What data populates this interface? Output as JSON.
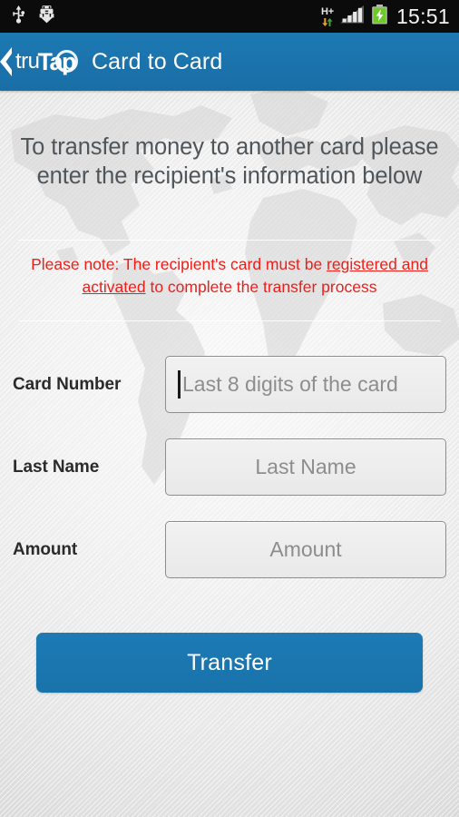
{
  "statusbar": {
    "time": "15:51",
    "network_type": "H+",
    "icons": [
      "usb-icon",
      "android-debug-icon",
      "network-hplus-icon",
      "signal-bars-icon",
      "battery-charging-icon"
    ]
  },
  "actionbar": {
    "back_icon": "back-chevron-icon",
    "logo_primary": "tru",
    "logo_secondary": "Tap",
    "title": "Card to Card",
    "background_color": "#1a6fa8"
  },
  "content": {
    "intro_line1": "To transfer money to another card please",
    "intro_line2": "enter the recipient's information below",
    "note_prefix": "Please note: The recipient's card must be ",
    "note_link": "registered and activated",
    "note_suffix": " to complete the transfer process",
    "note_color": "#f01d18"
  },
  "form": {
    "fields": [
      {
        "label": "Card Number",
        "placeholder": "Last 8 digits of the card",
        "value": "",
        "focused": true
      },
      {
        "label": "Last Name",
        "placeholder": "Last Name",
        "value": "",
        "focused": false
      },
      {
        "label": "Amount",
        "placeholder": "Amount",
        "value": "",
        "focused": false
      }
    ]
  },
  "actions": {
    "transfer_label": "Transfer",
    "transfer_color": "#1a74ae"
  }
}
